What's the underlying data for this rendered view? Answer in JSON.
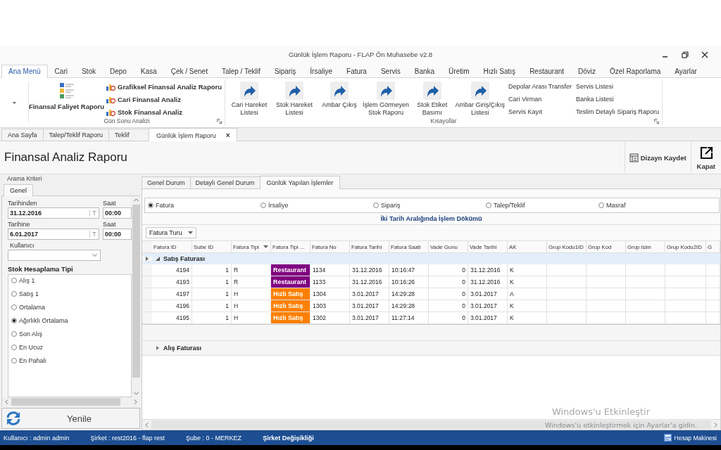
{
  "window": {
    "title": "Günlük İşlem Raporu - FLAP Ön Muhasebe v2.8"
  },
  "ribbon_tabs": [
    {
      "label": "Ana Menü",
      "selected": true
    },
    {
      "label": "Cari",
      "selected": false
    },
    {
      "label": "Stok",
      "selected": false
    },
    {
      "label": "Depo",
      "selected": false
    },
    {
      "label": "Kasa",
      "selected": false
    },
    {
      "label": "Çek / Senet",
      "selected": false
    },
    {
      "label": "Talep / Teklif",
      "selected": false
    },
    {
      "label": "Sipariş",
      "selected": false
    },
    {
      "label": "İrsaliye",
      "selected": false
    },
    {
      "label": "Fatura",
      "selected": false
    },
    {
      "label": "Servis",
      "selected": false
    },
    {
      "label": "Banka",
      "selected": false
    },
    {
      "label": "Üretim",
      "selected": false
    },
    {
      "label": "Hızlı Satış",
      "selected": false
    },
    {
      "label": "Restaurant",
      "selected": false
    },
    {
      "label": "Döviz",
      "selected": false
    },
    {
      "label": "Özel Raporlama",
      "selected": false
    },
    {
      "label": "Ayarlar",
      "selected": false
    }
  ],
  "ribbon_groups": [
    {
      "label": "Gün Sonu Analizi",
      "large_buttons": [
        "Finansal Faliyet Raporu"
      ],
      "small_columns": [
        [
          "Grafiksel Finansal Analiz Raporu",
          "Cari Finansal Analiz",
          "Stok Finansal Analiz"
        ]
      ]
    },
    {
      "label": "Kısayollar",
      "large_buttons": [
        "Cari Hareket\nListesi",
        "Stok Hareket\nListesi",
        "Ambar Çıkış",
        "İşlem Görmeyen\nStok Raporu",
        "Stok Etiket\nBasımı",
        "Ambar Giriş/Çıkış\nListesi"
      ],
      "small_columns": [
        [
          "Depolar Arası Transfer",
          "Cari Virman",
          "Servis Kayıt"
        ],
        [
          "Servis Listesi",
          "Banka Listesi",
          "Teslim Detaylı Sipariş Raporu"
        ]
      ]
    }
  ],
  "doc_tabs": [
    {
      "label": "Ana Sayfa",
      "selected": false
    },
    {
      "label": "Talep/Teklif Raporu",
      "selected": false
    },
    {
      "label": "Teklif",
      "selected": false
    },
    {
      "label": "Günlük İşlem Raporu",
      "selected": true,
      "close": "×"
    }
  ],
  "page": {
    "title": "Finansal Analiz Raporu",
    "actions": [
      {
        "kind": "design",
        "label": "Dizayn Kaydet"
      },
      {
        "kind": "close",
        "label": "Kapat"
      }
    ]
  },
  "criteria": {
    "legend": "Arama Kriteri",
    "tab": "Genel",
    "date_from": {
      "label": "Tarihinden",
      "value": "31.12.2016",
      "button": "T"
    },
    "time_from": {
      "label": "Saat",
      "value": "00:00"
    },
    "date_to": {
      "label": "Tarihine",
      "value": "6.01.2017",
      "button": "T"
    },
    "time_to": {
      "label": "Saat",
      "value": "00:00"
    },
    "user": {
      "label": "Kullanıcı"
    },
    "stock_calc": {
      "label": "Stok Hesaplama Tipi",
      "options": [
        {
          "label": "Alış 1",
          "selected": false
        },
        {
          "label": "Satış 1",
          "selected": false
        },
        {
          "label": "Ortalama",
          "selected": false
        },
        {
          "label": "Ağırlıklı Ortalama",
          "selected": true
        },
        {
          "label": "Son Alış",
          "selected": false
        },
        {
          "label": "En Ucuz",
          "selected": false
        },
        {
          "label": "En Pahalı",
          "selected": false
        }
      ]
    },
    "refresh_button": "Yenile"
  },
  "report_tabs": [
    {
      "label": "Genel Durum",
      "selected": false
    },
    {
      "label": "Detaylı Genel Durum",
      "selected": false
    },
    {
      "label": "Günlük Yapılan İşlemler",
      "selected": true
    }
  ],
  "doc_types": [
    {
      "label": "Fatura",
      "selected": true
    },
    {
      "label": "İrsaliye",
      "selected": false
    },
    {
      "label": "Sipariş",
      "selected": false
    },
    {
      "label": "Talep/Teklif",
      "selected": false
    },
    {
      "label": "Masraf",
      "selected": false
    }
  ],
  "grid_title": "İki Tarih Aralığında İşlem Dökümü",
  "group_by": "Fatura Turu",
  "columns": [
    {
      "label": "Fatura ID",
      "filter": false
    },
    {
      "label": "Sube ID",
      "filter": false
    },
    {
      "label": "Fatura Tipi",
      "filter": true
    },
    {
      "label": "Fatura Tipi ...",
      "filter": false
    },
    {
      "label": "Fatura No",
      "filter": false
    },
    {
      "label": "Fatura Tarihi",
      "filter": false
    },
    {
      "label": "Fatura Saati",
      "filter": false
    },
    {
      "label": "Vade Gunu",
      "filter": false
    },
    {
      "label": "Vade Tarihi",
      "filter": false
    },
    {
      "label": "AK",
      "filter": false
    },
    {
      "label": "Grup Kodu1ID",
      "filter": false
    },
    {
      "label": "Grup Kod",
      "filter": false
    },
    {
      "label": "Grup Isim",
      "filter": false
    },
    {
      "label": "Grup Kodu2ID",
      "filter": false
    },
    {
      "label": "G",
      "filter": false
    }
  ],
  "groups": [
    {
      "label": "Satış Faturası",
      "expanded": true,
      "rows": [
        {
          "cells": [
            "4194",
            "1",
            "R",
            "Restaurant",
            "1134",
            "31.12.2016",
            "10:16:47",
            "0",
            "31.12.2016",
            "K"
          ],
          "color": "#800080"
        },
        {
          "cells": [
            "4193",
            "1",
            "R",
            "Restaurant",
            "1133",
            "31.12.2016",
            "10:16:26",
            "0",
            "31.12.2016",
            "K"
          ],
          "color": "#800080"
        },
        {
          "cells": [
            "4197",
            "1",
            "H",
            "Hızlı Satış",
            "1304",
            "3.01.2017",
            "14:29:28",
            "0",
            "3.01.2017",
            "A"
          ],
          "color": "#ff8000"
        },
        {
          "cells": [
            "4196",
            "1",
            "H",
            "Hızlı Satış",
            "1303",
            "3.01.2017",
            "14:29:28",
            "0",
            "3.01.2017",
            "K"
          ],
          "color": "#ff8000"
        },
        {
          "cells": [
            "4195",
            "1",
            "H",
            "Hızlı Satış",
            "1302",
            "3.01.2017",
            "11:27:14",
            "0",
            "3.01.2017",
            "K"
          ],
          "color": "#ff8000"
        }
      ]
    },
    {
      "label": "Alış Faturası",
      "expanded": false
    }
  ],
  "activation": {
    "title": "Windows'u Etkinleştir",
    "text": "Windows'u etkinleştirmek için Ayarlar'a gidin."
  },
  "status_bar": {
    "items": [
      "Kullanıcı : admin admin",
      "Şirket : rest2016 - flap rest",
      "Şube : 0 - MERKEZ"
    ],
    "link": "Şirket Değişikliği",
    "calculator": "Hesap Makinesi"
  }
}
